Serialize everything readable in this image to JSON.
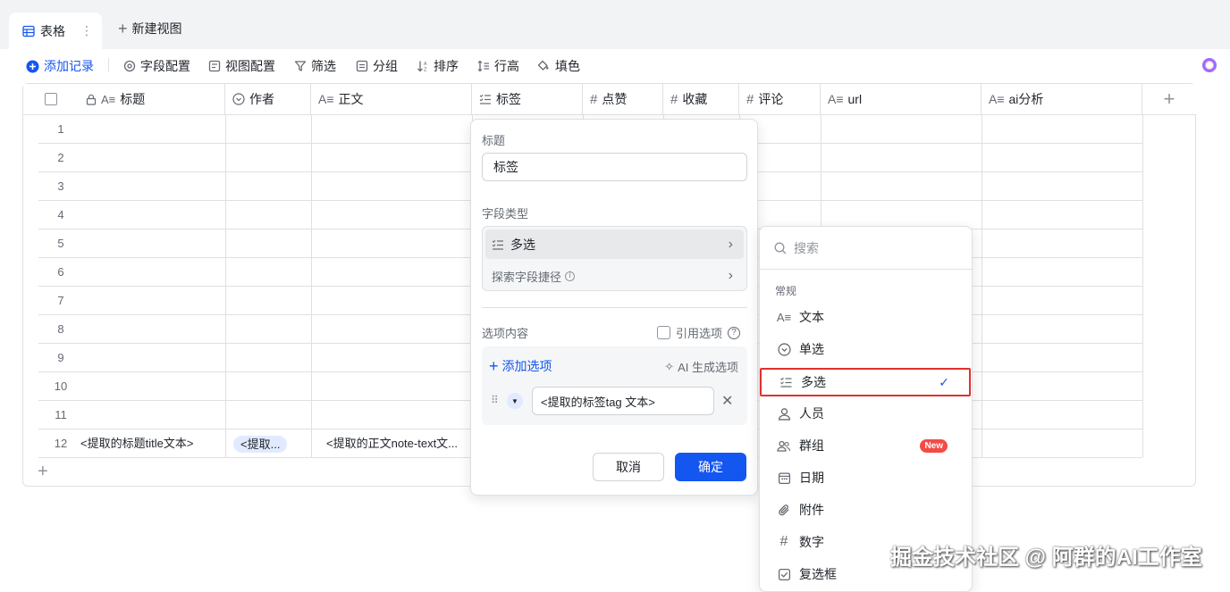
{
  "tabbar": {
    "active_tab": "表格",
    "new_view_label": "新建视图"
  },
  "toolbar": {
    "add_record": "添加记录",
    "field_config": "字段配置",
    "view_config": "视图配置",
    "filter": "筛选",
    "group": "分组",
    "sort": "排序",
    "row_height": "行高",
    "fill_color": "填色"
  },
  "table": {
    "columns": [
      "标题",
      "作者",
      "正文",
      "标签",
      "点赞",
      "收藏",
      "评论",
      "url",
      "ai分析"
    ],
    "row_numbers": [
      "1",
      "2",
      "3",
      "4",
      "5",
      "6",
      "7",
      "8",
      "9",
      "10",
      "11",
      "12"
    ],
    "row12": {
      "title": "<提取的标题title文本>",
      "author": "<提取...",
      "body": "<提取的正文note-text文..."
    }
  },
  "field_panel": {
    "title_label": "标题",
    "title_value": "标签",
    "type_label": "字段类型",
    "type_value": "多选",
    "explore_label": "探索字段捷径",
    "options_label": "选项内容",
    "reference_label": "引用选项",
    "add_option": "添加选项",
    "ai_generate": "AI 生成选项",
    "option_value": "<提取的标签tag 文本>",
    "cancel": "取消",
    "confirm": "确定"
  },
  "type_dropdown": {
    "search_placeholder": "搜索",
    "section": "常规",
    "items": [
      "文本",
      "单选",
      "多选",
      "人员",
      "群组",
      "日期",
      "附件",
      "数字",
      "复选框"
    ],
    "new_badge": "New",
    "selected": "多选"
  },
  "watermark": "掘金技术社区 @ 阿群的AI工作室",
  "colors": {
    "accent": "#1456f0",
    "highlight_border": "#e0312d",
    "new_badge": "#f54a45"
  }
}
